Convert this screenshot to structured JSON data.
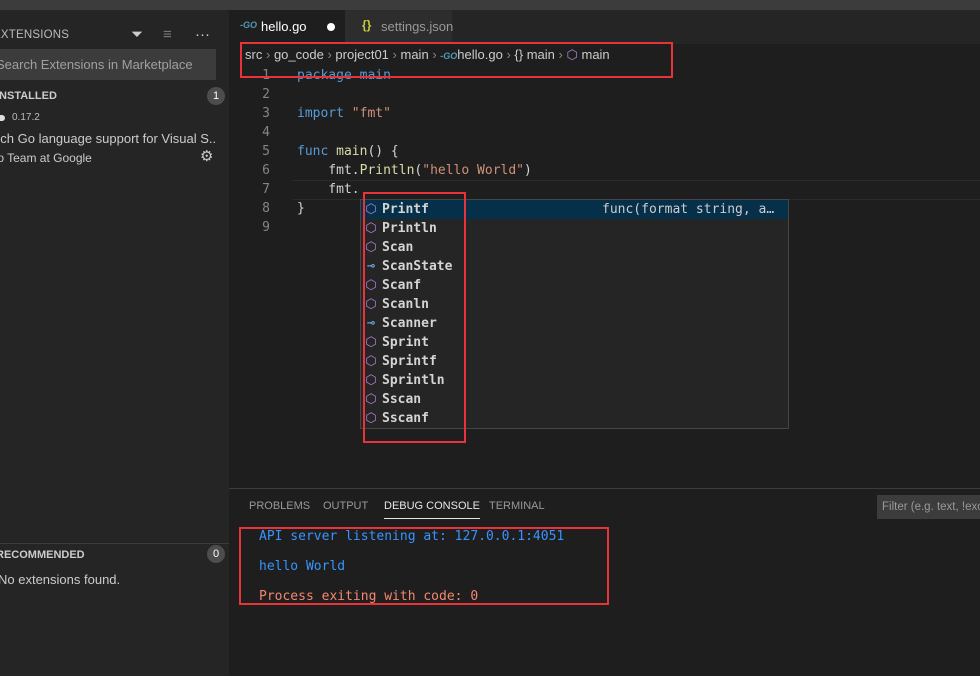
{
  "sidebar": {
    "title": "EXTENSIONS",
    "search_placeholder": "Search Extensions in Marketplace",
    "installed": {
      "label": "INSTALLED",
      "count": "1",
      "extension": {
        "version": "0.17.2",
        "description": "Rich Go language support for Visual S...",
        "publisher": "Go Team at Google"
      }
    },
    "recommended": {
      "label": "RECOMMENDED",
      "count": "0",
      "empty": "No extensions found."
    }
  },
  "tabs": [
    {
      "label": "hello.go",
      "icon": "go-file-icon",
      "dirty": true
    },
    {
      "label": "settings.json",
      "icon": "json-braces-icon"
    }
  ],
  "breadcrumb": [
    "src",
    "go_code",
    "project01",
    "main",
    "hello.go",
    "{} main",
    "main"
  ],
  "code": {
    "lines": [
      "package main",
      "",
      "import \"fmt\"",
      "",
      "func main() {",
      "    fmt.Println(\"hello World\")",
      "    fmt.",
      "}",
      ""
    ]
  },
  "suggest": {
    "items": [
      {
        "label": "Printf",
        "kind": "function",
        "detail": "func(format string, a…"
      },
      {
        "label": "Println",
        "kind": "function"
      },
      {
        "label": "Scan",
        "kind": "function"
      },
      {
        "label": "ScanState",
        "kind": "interface"
      },
      {
        "label": "Scanf",
        "kind": "function"
      },
      {
        "label": "Scanln",
        "kind": "function"
      },
      {
        "label": "Scanner",
        "kind": "interface"
      },
      {
        "label": "Sprint",
        "kind": "function"
      },
      {
        "label": "Sprintf",
        "kind": "function"
      },
      {
        "label": "Sprintln",
        "kind": "function"
      },
      {
        "label": "Sscan",
        "kind": "function"
      },
      {
        "label": "Sscanf",
        "kind": "function"
      }
    ]
  },
  "panel": {
    "tabs": [
      "PROBLEMS",
      "OUTPUT",
      "DEBUG CONSOLE",
      "TERMINAL"
    ],
    "active": "DEBUG CONSOLE",
    "filter_placeholder": "Filter (e.g. text, !exclude)",
    "console": [
      "API server listening at: 127.0.0.1:4051",
      "hello World",
      "Process exiting with code: 0"
    ]
  },
  "colors": {
    "highlight": "#e8333a",
    "console_info": "#3794ff",
    "console_error": "#f48771",
    "function_icon": "#b180d7",
    "interface_icon": "#75beff"
  }
}
